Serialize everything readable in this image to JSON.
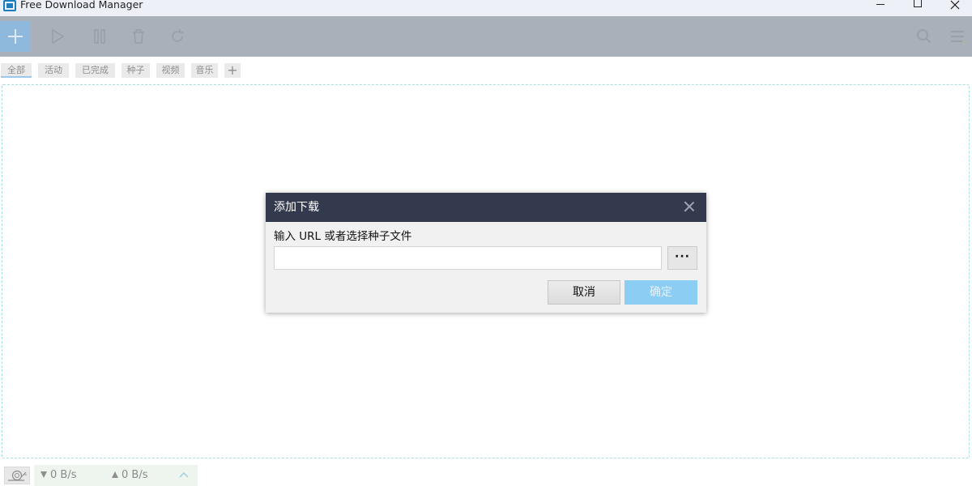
{
  "window": {
    "title": "Free Download Manager",
    "controls": [
      "minimize",
      "maximize",
      "close"
    ]
  },
  "toolbar": {
    "buttons": [
      "add-icon",
      "play-icon",
      "pause-icon",
      "trash-icon",
      "refresh-icon"
    ],
    "right_buttons": [
      "search-icon",
      "menu-icon"
    ]
  },
  "tabs": {
    "items": [
      {
        "label": "全部",
        "active": true
      },
      {
        "label": "活动",
        "active": false
      },
      {
        "label": "已完成",
        "active": false
      },
      {
        "label": "种子",
        "active": false
      },
      {
        "label": "视频",
        "active": false
      },
      {
        "label": "音乐",
        "active": false
      }
    ],
    "add_label": "+"
  },
  "dialog": {
    "title": "添加下载",
    "label": "输入 URL 或者选择种子文件",
    "input_value": "",
    "browse_label": "···",
    "cancel_label": "取消",
    "ok_label": "确定"
  },
  "statusbar": {
    "download_speed": "0 B/s",
    "upload_speed": "0 B/s"
  },
  "colors": {
    "dialog_header": "#333a4d",
    "ok_button": "#8ccdf3",
    "drop_border": "#a6dfe6"
  }
}
